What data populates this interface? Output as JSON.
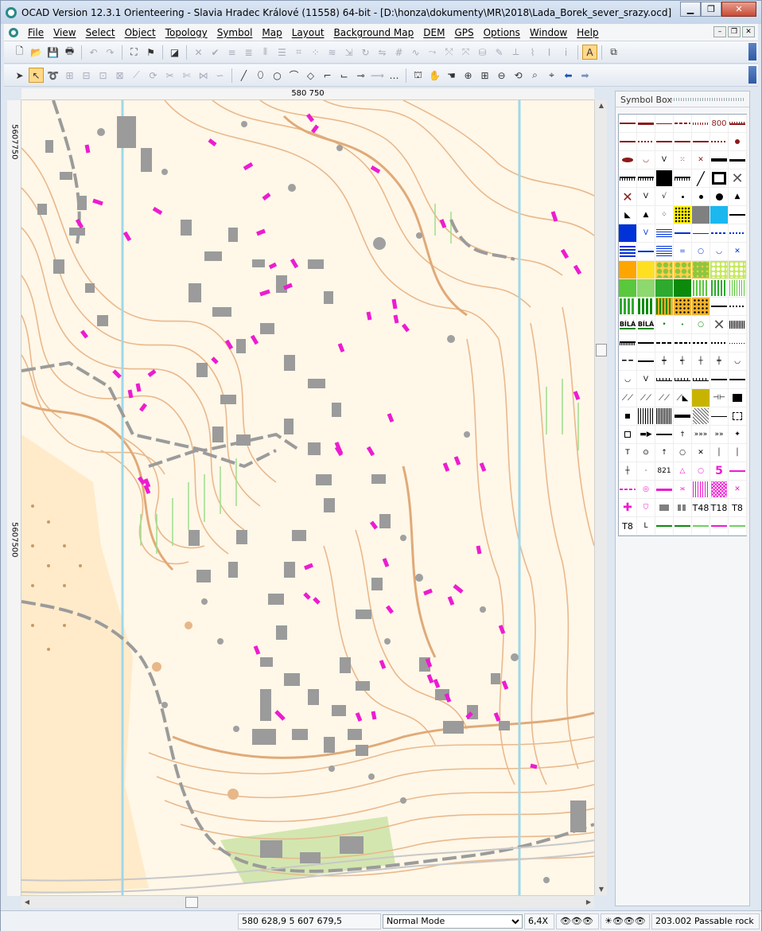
{
  "window": {
    "title": "OCAD Version 12.3.1  Orienteering - Slavia Hradec Králové (11558) 64-bit - [D:\\honza\\dokumenty\\MR\\2018\\Lada_Borek_sever_srazy.ocd]"
  },
  "menu": [
    "File",
    "View",
    "Select",
    "Object",
    "Topology",
    "Symbol",
    "Map",
    "Layout",
    "Background Map",
    "DEM",
    "GPS",
    "Options",
    "Window",
    "Help"
  ],
  "ruler": {
    "top_label": "580 750",
    "left_label_1": "5607750",
    "left_label_2": "5607500"
  },
  "symbol_box": {
    "title": "Symbol Box",
    "text_cells": [
      "800",
      "BÍLÁ",
      "BÍLÁ",
      "821",
      "5",
      "T48",
      "T18",
      "T8",
      "T8"
    ]
  },
  "status": {
    "coords": "580 628,9   5 607 679,5",
    "mode": "Normal Mode",
    "zoom": "6,4X",
    "symbol": "203.002 Passable rock"
  },
  "colors": {
    "contour": "#e9b98c",
    "building": "#9b9b9b",
    "magenta": "#ec1cd0",
    "blue": "#9ed8ea",
    "green": "#b7e7a3",
    "yellow": "#ffd9a0"
  }
}
